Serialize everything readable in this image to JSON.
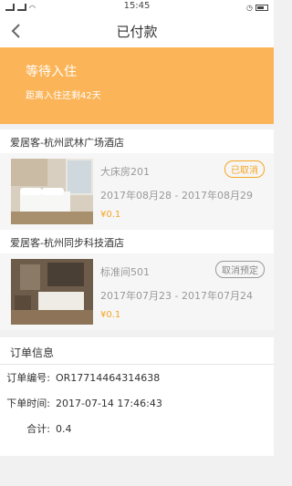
{
  "status_bar": {
    "time": "15:45"
  },
  "nav": {
    "title": "已付款"
  },
  "banner": {
    "title": "等待入住",
    "subtitle": "距离入住还剩42天"
  },
  "orders": [
    {
      "hotel": "爱居客-杭州武林广场酒店",
      "room": "大床房201",
      "dates": "2017年08月28 - 2017年08月29",
      "price": "¥0.1",
      "status": "已取消"
    },
    {
      "hotel": "爱居客-杭州同步科技酒店",
      "room": "标准间501",
      "dates": "2017年07月23 - 2017年07月24",
      "price": "¥0.1",
      "status": "取消预定"
    }
  ],
  "order_info": {
    "header": "订单信息",
    "rows": [
      {
        "label": "订单编号:",
        "value": "OR17714464314638"
      },
      {
        "label": "下单时间:",
        "value": "2017-07-14 17:46:43"
      },
      {
        "label": "合计:",
        "value": "0.4"
      }
    ]
  },
  "colors": {
    "accent": "#fbb458",
    "price": "#f5a623"
  }
}
